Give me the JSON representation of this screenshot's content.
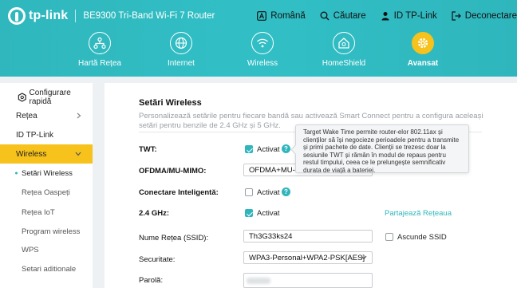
{
  "brand": {
    "logo_text": "tp-link",
    "model": "BE9300 Tri-Band Wi-Fi 7 Router"
  },
  "top_actions": [
    {
      "label": "Română",
      "icon": "language-icon"
    },
    {
      "label": "Căutare",
      "icon": "search-icon"
    },
    {
      "label": "ID TP-Link",
      "icon": "user-icon"
    },
    {
      "label": "Deconectare",
      "icon": "logout-icon"
    }
  ],
  "nav": [
    {
      "label": "Hartă Rețea",
      "icon": "network-map-icon"
    },
    {
      "label": "Internet",
      "icon": "globe-icon"
    },
    {
      "label": "Wireless",
      "icon": "wifi-icon"
    },
    {
      "label": "HomeShield",
      "icon": "home-shield-icon"
    },
    {
      "label": "Avansat",
      "icon": "gear-icon",
      "active": true
    }
  ],
  "sidebar": {
    "quick_setup": "Configurare rapidă",
    "items": [
      "Rețea",
      "ID TP-Link",
      "Wireless"
    ],
    "sub_items": [
      "Setări Wireless",
      "Rețea Oaspeți",
      "Rețea IoT",
      "Program wireless",
      "WPS",
      "Setari aditionale"
    ]
  },
  "main": {
    "title": "Setări Wireless",
    "description": "Personalizează setările pentru fiecare bandă sau activează Smart Connect pentru a configura aceleași setări pentru benzile de 2.4 GHz și 5 GHz.",
    "twt_label": "TWT:",
    "twt_value": "Activat",
    "ofdma_label": "OFDMA/MU-MIMO:",
    "ofdma_value": "OFDMA+MU-MIMO",
    "smart_label": "Conectare Inteligentă:",
    "smart_value": "Activat",
    "band_label": "2.4 GHz:",
    "band_value": "Activat",
    "share_link": "Partajează Rețeaua",
    "ssid_label": "Nume Rețea (SSID):",
    "ssid_value": "Th3G33ks24",
    "hide_ssid": "Ascunde SSID",
    "security_label": "Securitate:",
    "security_value": "WPA3-Personal+WPA2-PSK[AES]",
    "password_label": "Parolă:"
  },
  "tooltip": "Target Wake Time permite router-elor 802.11ax și clienților să își negocieze perioadele pentru a transmite și primi pachete de date. Clienții se trezesc doar la sesiunile TWT și rămân în modul de repaus pentru restul timpului, ceea ce le prelungește semnificativ durata de viață a bateriei.",
  "colors": {
    "header": "#31bfc5",
    "accent": "#2fb6bd",
    "active": "#f6c21b"
  }
}
